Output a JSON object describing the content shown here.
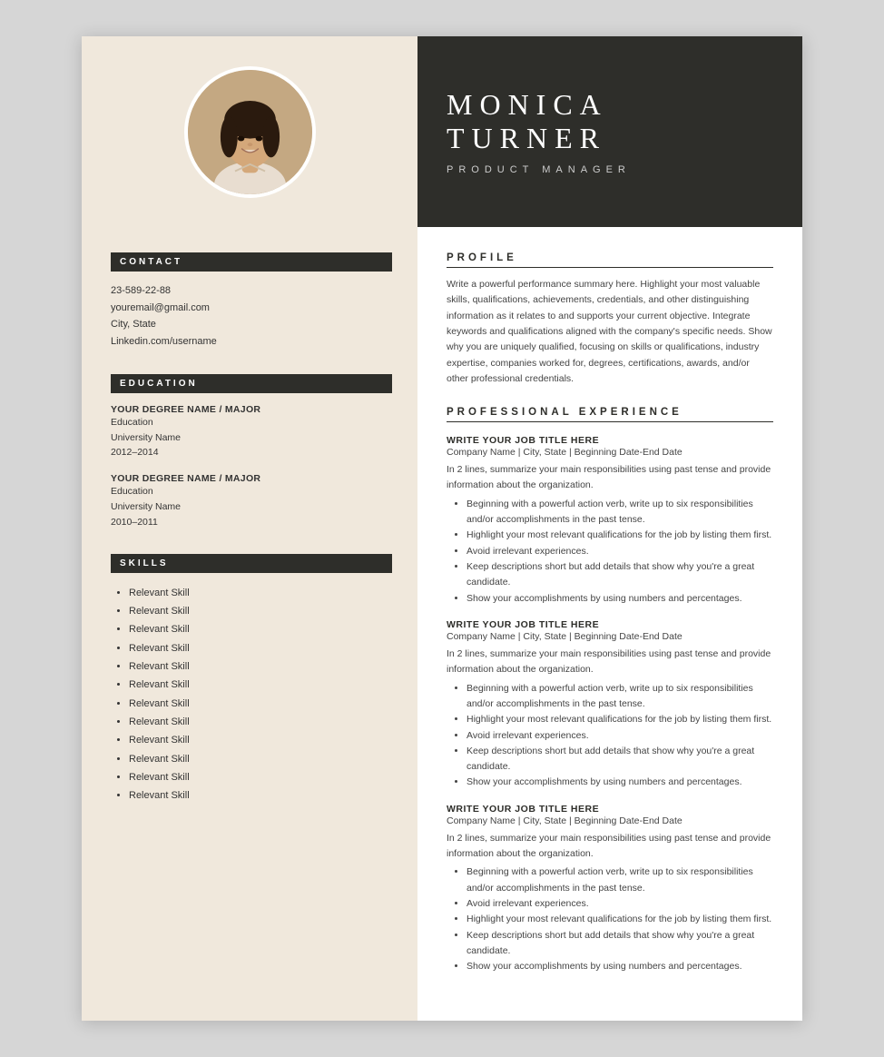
{
  "header": {
    "name": "MONICA  TURNER",
    "title": "PRODUCT  MANAGER"
  },
  "sidebar": {
    "contact_heading": "CONTACT",
    "contact": {
      "phone": "23-589-22-88",
      "email": "youremail@gmail.com",
      "location": "City, State",
      "linkedin": "Linkedin.com/username"
    },
    "education_heading": "EDUCATION",
    "education": [
      {
        "degree": "YOUR DEGREE NAME / MAJOR",
        "field": "Education",
        "school": "University Name",
        "years": "2012–2014"
      },
      {
        "degree": "YOUR DEGREE NAME / MAJOR",
        "field": "Education",
        "school": "University Name",
        "years": "2010–2011"
      }
    ],
    "skills_heading": "SKILLS",
    "skills": [
      "Relevant Skill",
      "Relevant Skill",
      "Relevant Skill",
      "Relevant Skill",
      "Relevant Skill",
      "Relevant Skill",
      "Relevant Skill",
      "Relevant Skill",
      "Relevant Skill",
      "Relevant Skill",
      "Relevant Skill",
      "Relevant Skill"
    ]
  },
  "main": {
    "profile_heading": "PROFILE",
    "profile_text": "Write a powerful performance summary here. Highlight your most valuable skills, qualifications, achievements, credentials, and other distinguishing information as it relates to and supports your current objective. Integrate keywords and qualifications aligned with the company's specific needs. Show why you are uniquely qualified, focusing on skills or qualifications, industry expertise, companies worked for, degrees, certifications, awards, and/or other professional credentials.",
    "experience_heading": "PROFESSIONAL  EXPERIENCE",
    "jobs": [
      {
        "title": "WRITE YOUR JOB TITLE HERE",
        "company": "Company Name | City, State | Beginning Date-End Date",
        "desc": "In 2 lines, summarize your main responsibilities using past tense and provide information about the organization.",
        "bullets": [
          "Beginning with a powerful action verb, write up to six responsibilities and/or accomplishments in the past tense.",
          "Highlight your most relevant qualifications for the job by listing them first.",
          "Avoid irrelevant experiences.",
          "Keep descriptions short but add details that show why you're a great candidate.",
          "Show your accomplishments by using numbers and percentages."
        ]
      },
      {
        "title": "WRITE YOUR JOB TITLE HERE",
        "company": "Company Name | City, State | Beginning Date-End Date",
        "desc": "In 2 lines, summarize your main responsibilities using past tense and provide information about the organization.",
        "bullets": [
          "Beginning with a powerful action verb, write up to six responsibilities and/or accomplishments in the past tense.",
          "Highlight your most relevant qualifications for the job by listing them first.",
          "Avoid irrelevant experiences.",
          "Keep descriptions short but add details that show why you're a great candidate.",
          "Show your accomplishments by using numbers and percentages."
        ]
      },
      {
        "title": "WRITE YOUR JOB TITLE HERE",
        "company": "Company Name | City, State | Beginning Date-End Date",
        "desc": "In 2 lines, summarize your main responsibilities using past tense and provide information about the organization.",
        "bullets": [
          "Beginning with a powerful action verb, write up to six responsibilities and/or accomplishments in the past tense.",
          "Avoid irrelevant experiences.",
          "Highlight your most relevant qualifications for the job by listing them first.",
          "Keep descriptions short but add details that show why you're a great candidate.",
          "Show your accomplishments by using numbers and percentages."
        ]
      }
    ]
  }
}
